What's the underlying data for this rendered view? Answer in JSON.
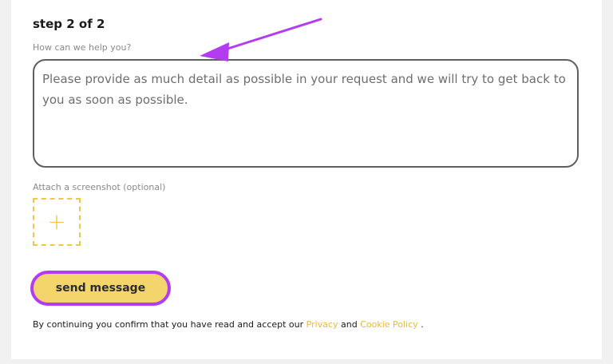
{
  "form": {
    "step_title": "step 2 of 2",
    "help_label": "How can we help you?",
    "message_placeholder": "Please provide as much detail as possible in your request and we will try to get back to you as soon as possible.",
    "message_value": "",
    "attach_label": "Attach a screenshot (optional)",
    "attach_icon": "plus-icon",
    "attach_icon_glyph": "+",
    "send_label": "send message"
  },
  "consent": {
    "prefix": "By continuing you confirm that you have read and accept our",
    "privacy_link": "Privacy",
    "conjunction": "and",
    "cookie_link": "Cookie Policy",
    "suffix": "."
  },
  "colors": {
    "accent_yellow": "#f3d56c",
    "link_yellow": "#e8b93b",
    "annotation_purple": "#b43cf0"
  }
}
